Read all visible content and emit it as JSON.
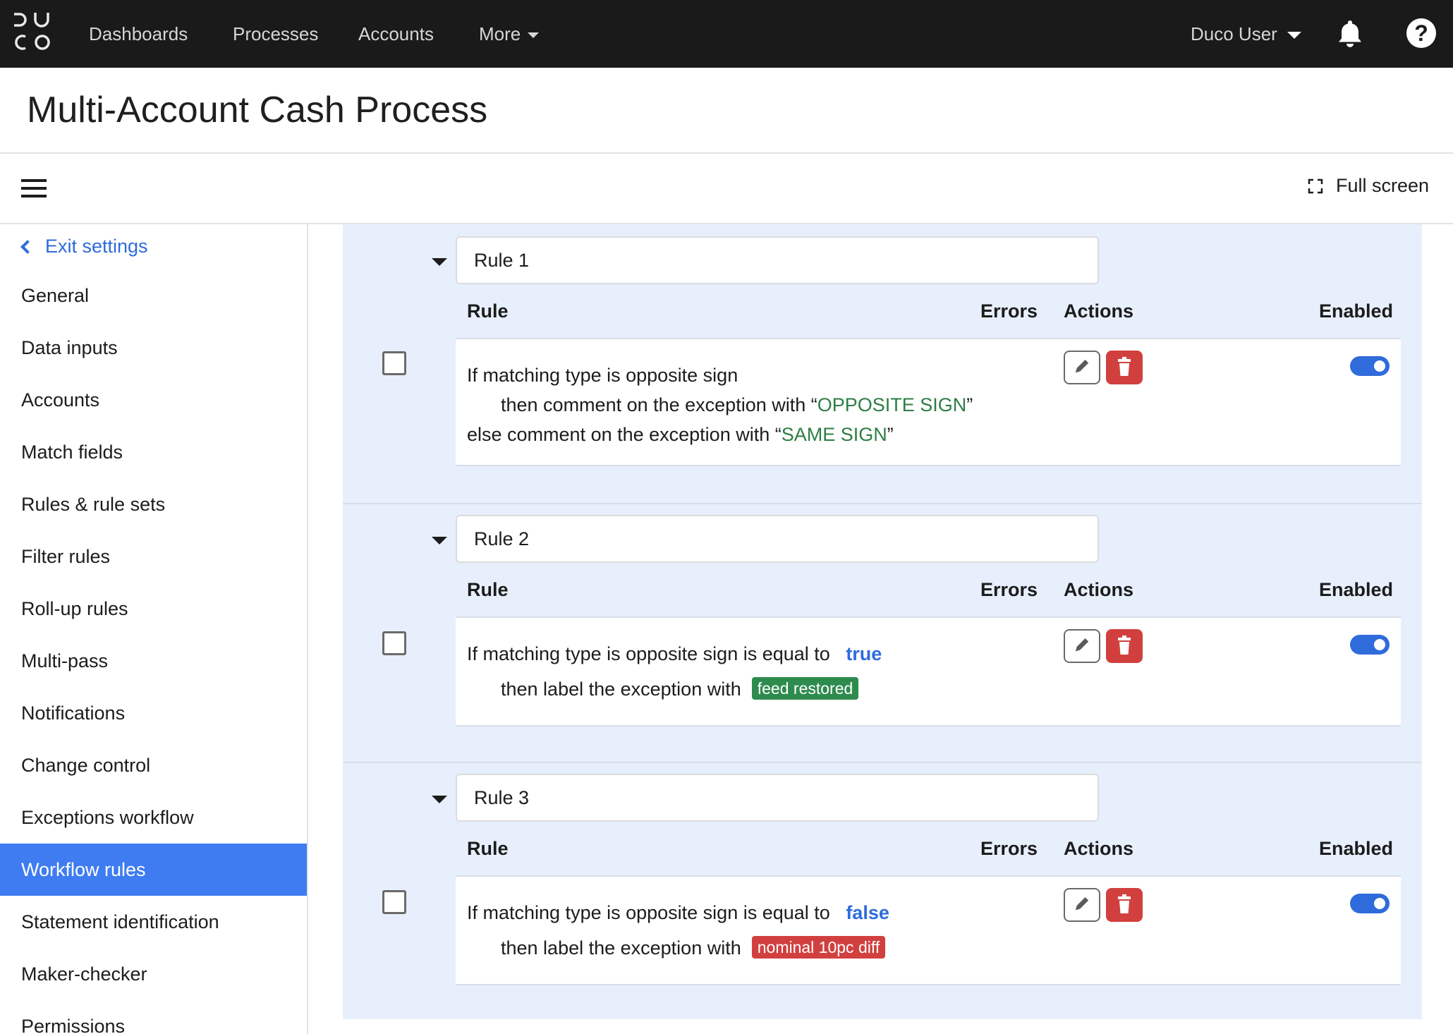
{
  "nav": {
    "logo_text": "DUCO",
    "links": [
      {
        "label": "Dashboards"
      },
      {
        "label": "Processes"
      },
      {
        "label": "Accounts"
      },
      {
        "label": "More"
      }
    ],
    "user_label": "Duco User",
    "help_glyph": "?"
  },
  "page": {
    "title": "Multi-Account Cash Process"
  },
  "toolbar": {
    "fullscreen_label": "Full screen"
  },
  "sidebar": {
    "exit_label": "Exit settings",
    "items": [
      {
        "label": "General"
      },
      {
        "label": "Data inputs"
      },
      {
        "label": "Accounts"
      },
      {
        "label": "Match fields"
      },
      {
        "label": "Rules & rule sets"
      },
      {
        "label": "Filter rules"
      },
      {
        "label": "Roll-up rules"
      },
      {
        "label": "Multi-pass"
      },
      {
        "label": "Notifications"
      },
      {
        "label": "Change control"
      },
      {
        "label": "Exceptions workflow"
      },
      {
        "label": "Workflow rules",
        "active": true
      },
      {
        "label": "Statement identification"
      },
      {
        "label": "Maker-checker"
      },
      {
        "label": "Permissions"
      }
    ]
  },
  "columns": {
    "rule": "Rule",
    "errors": "Errors",
    "actions": "Actions",
    "enabled": "Enabled"
  },
  "rules": [
    {
      "name": "Rule 1",
      "enabled": true,
      "if_text": "If  matching type is opposite sign",
      "then_prefix": "then  comment on the exception with “",
      "then_value": "OPPOSITE SIGN",
      "then_suffix": "”",
      "else_prefix": "else  comment on the exception with “",
      "else_value": "SAME SIGN",
      "else_suffix": "”"
    },
    {
      "name": "Rule 2",
      "enabled": true,
      "if_text": "If  matching type is opposite sign  is equal to",
      "if_value": "true",
      "then_text": "then  label the exception with",
      "tag": "feed restored",
      "tag_color": "#2e8b4e"
    },
    {
      "name": "Rule 3",
      "enabled": true,
      "if_text": "If  matching type is opposite sign  is equal to",
      "if_value": "false",
      "then_text": "then  label the exception with",
      "tag": "nominal 10pc diff",
      "tag_color": "#d1403f"
    }
  ],
  "colors": {
    "topbar": "#1a1a1a",
    "accent": "#3f7cf1",
    "panel": "#e7effc",
    "green": "#2e7d44",
    "danger": "#d1403f"
  }
}
